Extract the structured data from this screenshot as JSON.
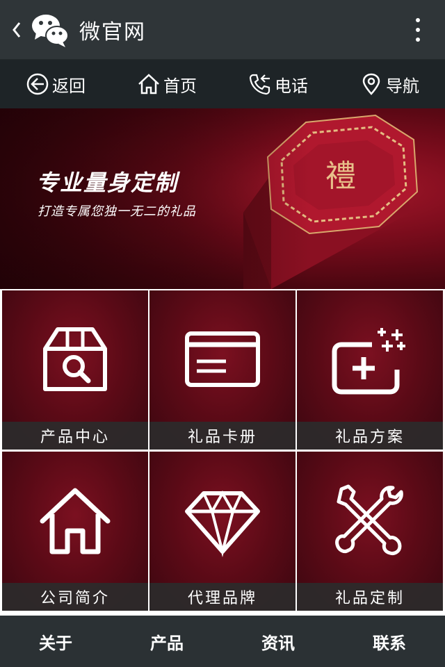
{
  "header": {
    "back_icon": "chevron-left-icon",
    "logo_icon": "wechat-icon",
    "title": "微官网",
    "menu_icon": "more-vertical-icon"
  },
  "nav": {
    "items": [
      {
        "icon": "arrow-left-circle-icon",
        "label": "返回"
      },
      {
        "icon": "home-icon",
        "label": "首页"
      },
      {
        "icon": "phone-icon",
        "label": "电话"
      },
      {
        "icon": "map-pin-icon",
        "label": "导航"
      }
    ]
  },
  "banner": {
    "headline": "专业量身定制",
    "subline": "打造专属您独一无二的礼品",
    "box_character": "禮"
  },
  "grid": {
    "items": [
      {
        "icon": "box-search-icon",
        "label": "产品中心"
      },
      {
        "icon": "card-icon",
        "label": "礼品卡册"
      },
      {
        "icon": "plus-sparkle-icon",
        "label": "礼品方案"
      },
      {
        "icon": "house-icon",
        "label": "公司简介"
      },
      {
        "icon": "diamond-icon",
        "label": "代理品牌"
      },
      {
        "icon": "tools-icon",
        "label": "礼品定制"
      }
    ]
  },
  "tabs": {
    "items": [
      {
        "label": "关于"
      },
      {
        "label": "产品"
      },
      {
        "label": "资讯"
      },
      {
        "label": "联系"
      }
    ]
  },
  "colors": {
    "bar_dark": "#2f3538",
    "nav_dark": "#1e2427",
    "banner_red": "#a8182c",
    "label_bg": "#2b2b2b"
  }
}
